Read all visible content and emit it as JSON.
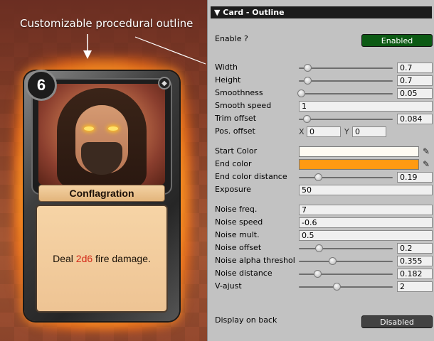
{
  "scene": {
    "caption": "Customizable procedural outline",
    "card": {
      "cost": "6",
      "name": "Conflagration",
      "text_before": "Deal ",
      "text_dice": "2d6",
      "text_after": " fire damage.",
      "gem_icon": "diamond-icon"
    }
  },
  "inspector": {
    "title": "▼ Card - Outline",
    "enable_label": "Enable ?",
    "enable_value": "Enabled",
    "rows": {
      "width": {
        "label": "Width",
        "value": "0.7",
        "level": 0.7
      },
      "height": {
        "label": "Height",
        "value": "0.7",
        "level": 0.7
      },
      "smoothness": {
        "label": "Smoothness",
        "value": "0.05",
        "level": 0.05
      },
      "smooth_speed": {
        "label": "Smooth speed",
        "value": "1"
      },
      "trim_offset": {
        "label": "Trim offset",
        "value": "0.084",
        "level": 0.084
      },
      "pos_offset": {
        "label": "Pos. offset",
        "x_label": "X",
        "x_value": "0",
        "y_label": "Y",
        "y_value": "0"
      },
      "start_color": {
        "label": "Start Color",
        "color": "#fffbf2"
      },
      "end_color": {
        "label": "End color",
        "color": "#ff9a12"
      },
      "end_color_distance": {
        "label": "End color distance",
        "value": "0.19",
        "level": 0.19
      },
      "exposure": {
        "label": "Exposure",
        "value": "50"
      },
      "noise_freq": {
        "label": "Noise freq.",
        "value": "7"
      },
      "noise_speed": {
        "label": "Noise speed",
        "value": "-0.6"
      },
      "noise_mult": {
        "label": "Noise mult.",
        "value": "0.5"
      },
      "noise_offset": {
        "label": "Noise offset",
        "value": "0.2",
        "level": 0.2
      },
      "noise_alpha_threshold": {
        "label": "Noise alpha threshol",
        "value": "0.355",
        "level": 0.355
      },
      "noise_distance": {
        "label": "Noise distance",
        "value": "0.182",
        "level": 0.182
      },
      "v_ajust": {
        "label": "V-ajust",
        "value": "2",
        "level": 0.4
      }
    },
    "display_on_back_label": "Display on back",
    "display_on_back_value": "Disabled"
  }
}
